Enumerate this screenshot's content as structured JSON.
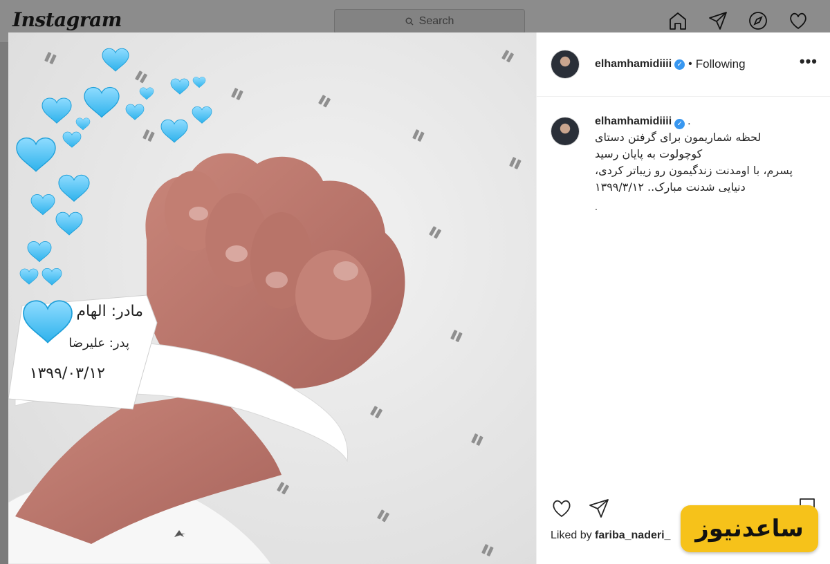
{
  "topbar": {
    "logo": "Instagram",
    "search_placeholder": "Search",
    "icons": [
      "home-icon",
      "direct-icon",
      "explore-icon",
      "activity-heart-icon"
    ]
  },
  "post": {
    "username": "elhamhamidiiii",
    "follow_status": "Following",
    "separator": "•",
    "more_label": "•••",
    "caption": {
      "username": "elhamhamidiiii",
      "dot": ".",
      "lines": [
        "لحظه شماریمون برای گرفتن دستای",
        "کوچولوت به پایان رسید",
        "پسرم، با اومدنت زندگیمون رو زیباتر کردی،",
        "دنیایی شدنت مبارک.. ۱۳۹۹/۳/۱۲"
      ],
      "trailer": "."
    },
    "liked_by_prefix": "Liked by",
    "liked_by_user": "fariba_naderi_",
    "image": {
      "wristband_lines": [
        "مادر: الهام",
        "پدر: علیرضا",
        "۱۳۹۹/۰۳/۱۲"
      ]
    }
  },
  "watermark": {
    "text": "ساعدنیوز",
    "color": "#f6c21a"
  },
  "colors": {
    "verified": "#3897f0",
    "heart": "#5fc6f2"
  }
}
